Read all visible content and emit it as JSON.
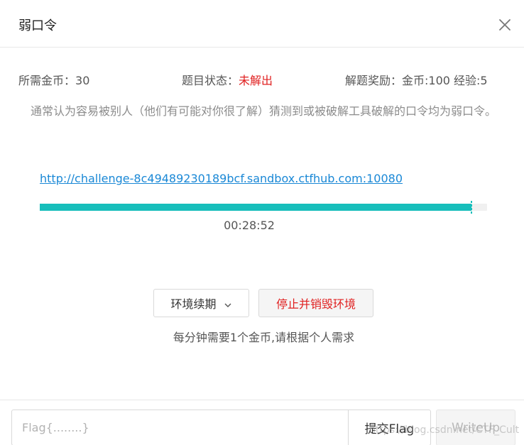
{
  "dialog": {
    "title": "弱口令",
    "close_icon": "close-icon"
  },
  "info": {
    "cost_label": "所需金币：",
    "cost_value": "30",
    "status_label": "题目状态：",
    "status_value": "未解出",
    "reward_label": "解题奖励：",
    "reward_value": "金币:100 经验:5"
  },
  "description": "通常认为容易被别人（他们有可能对你很了解）猜测到或被破解工具破解的口令均为弱口令。",
  "environment": {
    "url": "http://challenge-8c49489230189bcf.sandbox.ctfhub.com:10080",
    "progress_percent": 96.5,
    "remaining_time": "00:28:52"
  },
  "actions": {
    "renew_label": "环境续期",
    "stop_label": "停止并销毁环境",
    "cost_note": "每分钟需要1个金币,请根据个人需求"
  },
  "footer": {
    "flag_placeholder": "Flag{........}",
    "submit_label": "提交Flag",
    "writeup_label": "WriteUp"
  },
  "colors": {
    "accent": "#17bebb",
    "status_red": "#e02020",
    "link_blue": "#1a88d6"
  },
  "watermark": "https://blog.csdn.net/CTF_Cult"
}
